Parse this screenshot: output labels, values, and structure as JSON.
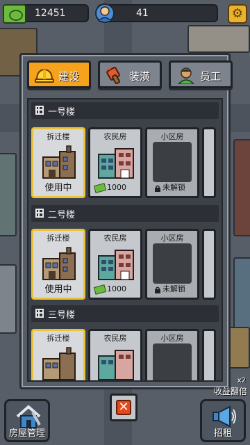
{
  "topbar": {
    "cash_value": "12451",
    "staff_value": "41",
    "cash_icon": "cash-icon",
    "staff_icon": "staff-avatar-icon",
    "settings_icon": "gear-icon"
  },
  "tabs": [
    {
      "label": "建设",
      "icon": "hardhat-icon",
      "active": true
    },
    {
      "label": "装潢",
      "icon": "paint-brush-icon",
      "active": false
    },
    {
      "label": "员工",
      "icon": "worker-icon",
      "active": false
    }
  ],
  "sections": [
    {
      "title": "一号楼",
      "cards": [
        {
          "name": "拆迁楼",
          "status": "使用中"
        },
        {
          "name": "农民房",
          "price": "1000"
        },
        {
          "name": "小区房",
          "locked_text": "未解锁"
        }
      ]
    },
    {
      "title": "二号楼",
      "cards": [
        {
          "name": "拆迁楼",
          "status": "使用中"
        },
        {
          "name": "农民房",
          "price": "1000"
        },
        {
          "name": "小区房",
          "locked_text": "未解锁"
        }
      ]
    },
    {
      "title": "三号楼",
      "cards": [
        {
          "name": "拆迁楼"
        },
        {
          "name": "农民房"
        },
        {
          "name": "小区房"
        }
      ]
    }
  ],
  "bottom": {
    "left_button_label": "房屋管理",
    "right_button_label": "招租",
    "boost_label": "收益翻倍",
    "boost_multiplier": "x2",
    "close_icon": "close-icon"
  },
  "colors": {
    "accent_orange": "#f6a21c",
    "selected_border": "#e9c33a",
    "panel_bg": "#565d66",
    "close_red": "#e24a1d"
  }
}
